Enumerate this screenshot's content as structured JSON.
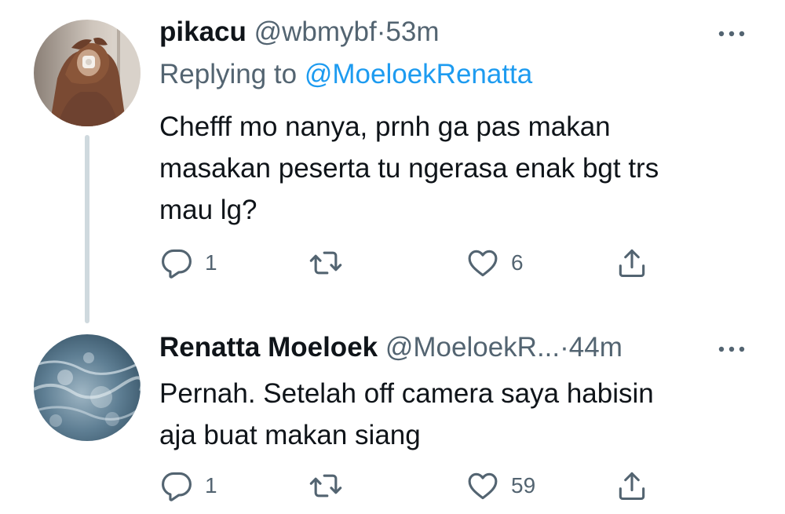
{
  "thread": {
    "tweets": [
      {
        "display_name": "pikacu",
        "handle": "@wbmybf",
        "separator": "·",
        "time": "53m",
        "replying_prefix": "Replying to",
        "replying_to": "@MoeloekRenatta",
        "text": "Chefff mo nanya, prnh ga pas makan\nmasakan peserta tu ngerasa enak bgt trs\nmau lg?",
        "replies": "1",
        "likes": "6",
        "avatar_icon": "user-photo-avatar"
      },
      {
        "display_name": "Renatta Moeloek",
        "handle": "@MoeloekR...",
        "separator": "·",
        "time": "44m",
        "text": "Pernah. Setelah off camera saya habisin\naja buat makan siang",
        "replies": "1",
        "likes": "59",
        "avatar_icon": "ocean-photo-avatar"
      }
    ]
  },
  "colors": {
    "primary_text": "#0f1419",
    "secondary_text": "#536471",
    "link": "#1d9bf0",
    "thread_line": "#cfd9de",
    "background": "#ffffff"
  },
  "icons": {
    "reply": "reply-icon",
    "retweet": "retweet-icon",
    "like": "heart-icon",
    "share": "share-icon",
    "more": "more-dots-icon"
  }
}
